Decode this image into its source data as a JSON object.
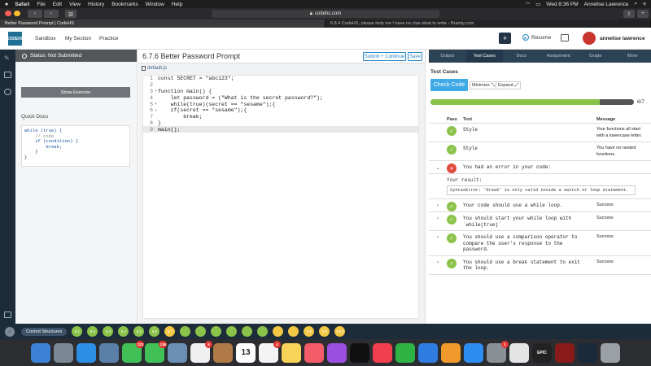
{
  "menubar": {
    "apple": "",
    "items": [
      "Safari",
      "File",
      "Edit",
      "View",
      "History",
      "Bookmarks",
      "Window",
      "Help"
    ],
    "clock": "Wed 8:36 PM",
    "user": "Annelise Lawrence"
  },
  "browser": {
    "url": "codehs.com",
    "tabs": [
      {
        "title": "Better Password Prompt | CodeHS",
        "active": true
      },
      {
        "title": "6.8.4 CodeHS, please help me I have no clue what to write › Brainly.com",
        "active": false
      }
    ]
  },
  "header": {
    "logo": "CODEHS",
    "nav": [
      "Sandbox",
      "My Section",
      "Practice"
    ],
    "plus": "+",
    "resume": "Resume",
    "username": "annelise lawrence"
  },
  "leftpanel": {
    "status": "Status: Not Submitted",
    "show_exercise": "Show Exercise",
    "quick_docs_title": "Quick Docs",
    "quick_docs_code": [
      "while (true) {",
      "    // code",
      "    if (condition) {",
      "        break;",
      "    }",
      "}"
    ]
  },
  "editor": {
    "title": "6.7.6 Better Password Prompt",
    "submit_label": "Submit + Continue",
    "save_label": "Save",
    "filename": "default.js",
    "lines": [
      {
        "n": "1",
        "fold": "",
        "text": "const SECRET = \"abc123\";"
      },
      {
        "n": "2",
        "fold": "",
        "text": ""
      },
      {
        "n": "3",
        "fold": "▾",
        "text": "function main() {"
      },
      {
        "n": "4",
        "fold": "",
        "text": "    let password = (\"What is the secret password?\");"
      },
      {
        "n": "5",
        "fold": "▾",
        "text": "    while(true)(secret == \"sesame\");{"
      },
      {
        "n": "6",
        "fold": "▾",
        "text": "    if(secret == \"sesame\");{"
      },
      {
        "n": "7",
        "fold": "",
        "text": "        break;"
      },
      {
        "n": "8",
        "fold": "",
        "text": "}"
      },
      {
        "n": "9",
        "fold": "",
        "text": "main();"
      }
    ]
  },
  "rightpanel": {
    "tabs": [
      "Output",
      "Test Cases",
      "Docs",
      "Assignment",
      "Grade",
      "More"
    ],
    "active_tab": "Test Cases",
    "title": "Test Cases",
    "check_code": "Check Code",
    "minimize": "Minimize",
    "expand": "Expand",
    "progress_fraction": 0.8333,
    "progress_text": "6/7",
    "columns": {
      "pass": "Pass",
      "test": "Test",
      "message": "Message"
    },
    "rows": [
      {
        "exp": "",
        "status": "ok",
        "test": "Style",
        "message": "Your functions all start with a lowercase letter."
      },
      {
        "exp": "",
        "status": "ok",
        "test": "Style",
        "message": "You have no nested functions."
      },
      {
        "exp": "⌄",
        "status": "err",
        "test": "You had an error in your code:",
        "message": ""
      },
      {
        "exp": "›",
        "status": "ok",
        "test": "Your code should use a while loop.",
        "message": "Success"
      },
      {
        "exp": "›",
        "status": "ok",
        "test": "You should start your while loop with `while(true)`",
        "message": "Success"
      },
      {
        "exp": "›",
        "status": "ok",
        "test": "You should use a comparison operator to compare the user's response to the password.",
        "message": "Success"
      },
      {
        "exp": "›",
        "status": "ok",
        "test": "You should use a break statement to exit the loop.",
        "message": "Success"
      }
    ],
    "error_result_label": "Your result:",
    "error_text": "SyntaxError: 'break' is only valid inside a switch or loop statement."
  },
  "bottombar": {
    "unit": "Control Structures",
    "bubbles": [
      {
        "label": "6.1",
        "color": "#8bc34a"
      },
      {
        "label": "6.2",
        "color": "#8bc34a"
      },
      {
        "label": "6.3",
        "color": "#8bc34a"
      },
      {
        "label": "6.4",
        "color": "#8bc34a"
      },
      {
        "label": "6.5",
        "color": "#8bc34a"
      },
      {
        "label": "6.6",
        "color": "#8bc34a"
      },
      {
        "label": "6.7",
        "color": "#f2c744"
      },
      {
        "label": "",
        "color": "#8bc34a"
      },
      {
        "label": "",
        "color": "#8bc34a"
      },
      {
        "label": "",
        "color": "#8bc34a"
      },
      {
        "label": "",
        "color": "#8bc34a"
      },
      {
        "label": "",
        "color": "#8bc34a"
      },
      {
        "label": "",
        "color": "#8bc34a"
      },
      {
        "label": "",
        "color": "#f2c744"
      },
      {
        "label": "",
        "color": "#f2c744"
      },
      {
        "label": "6.8",
        "color": "#f2c744"
      },
      {
        "label": "6.9",
        "color": "#f2c744"
      },
      {
        "label": "6.10",
        "color": "#f2c744"
      }
    ]
  },
  "dock": {
    "apps": [
      {
        "name": "finder-icon",
        "color": "#3b82d6",
        "badge": ""
      },
      {
        "name": "launchpad-icon",
        "color": "#7b8794",
        "badge": ""
      },
      {
        "name": "safari-icon",
        "color": "#2c8fe6",
        "badge": ""
      },
      {
        "name": "photo-app-icon",
        "color": "#5a7fa8",
        "badge": ""
      },
      {
        "name": "messages-icon",
        "color": "#40c057",
        "badge": "123"
      },
      {
        "name": "facetime-icon",
        "color": "#40c057",
        "badge": "136"
      },
      {
        "name": "preview-icon",
        "color": "#6b8fb3",
        "badge": ""
      },
      {
        "name": "photos-icon",
        "color": "#f0f0f0",
        "badge": "6"
      },
      {
        "name": "contacts-icon",
        "color": "#b07a48",
        "badge": ""
      },
      {
        "name": "calendar-icon",
        "color": "#ffffff",
        "badge": ""
      },
      {
        "name": "reminders-icon",
        "color": "#f4f4f4",
        "badge": "4"
      },
      {
        "name": "notes-icon",
        "color": "#f7d358",
        "badge": ""
      },
      {
        "name": "music-icon",
        "color": "#f45b69",
        "badge": ""
      },
      {
        "name": "podcasts-icon",
        "color": "#9b4ee0",
        "badge": ""
      },
      {
        "name": "tv-icon",
        "color": "#111111",
        "badge": ""
      },
      {
        "name": "news-icon",
        "color": "#f03e4e",
        "badge": ""
      },
      {
        "name": "numbers-icon",
        "color": "#2fb344",
        "badge": ""
      },
      {
        "name": "keynote-icon",
        "color": "#2f7de1",
        "badge": ""
      },
      {
        "name": "pages-icon",
        "color": "#f09a2c",
        "badge": ""
      },
      {
        "name": "app-store-icon",
        "color": "#2d8cf0",
        "badge": ""
      },
      {
        "name": "system-preferences-icon",
        "color": "#8a8f96",
        "badge": "1"
      },
      {
        "name": "roblox-icon",
        "color": "#e4e4e4",
        "badge": ""
      },
      {
        "name": "epic-games-icon",
        "color": "#222222",
        "badge": ""
      },
      {
        "name": "flash-icon",
        "color": "#8a1a1a",
        "badge": ""
      },
      {
        "name": "league-icon",
        "color": "#1a2a3a",
        "badge": ""
      },
      {
        "name": "trash-icon",
        "color": "#9aa0a6",
        "badge": ""
      }
    ],
    "calendar_day": "13",
    "epic_label": "EPIC"
  }
}
